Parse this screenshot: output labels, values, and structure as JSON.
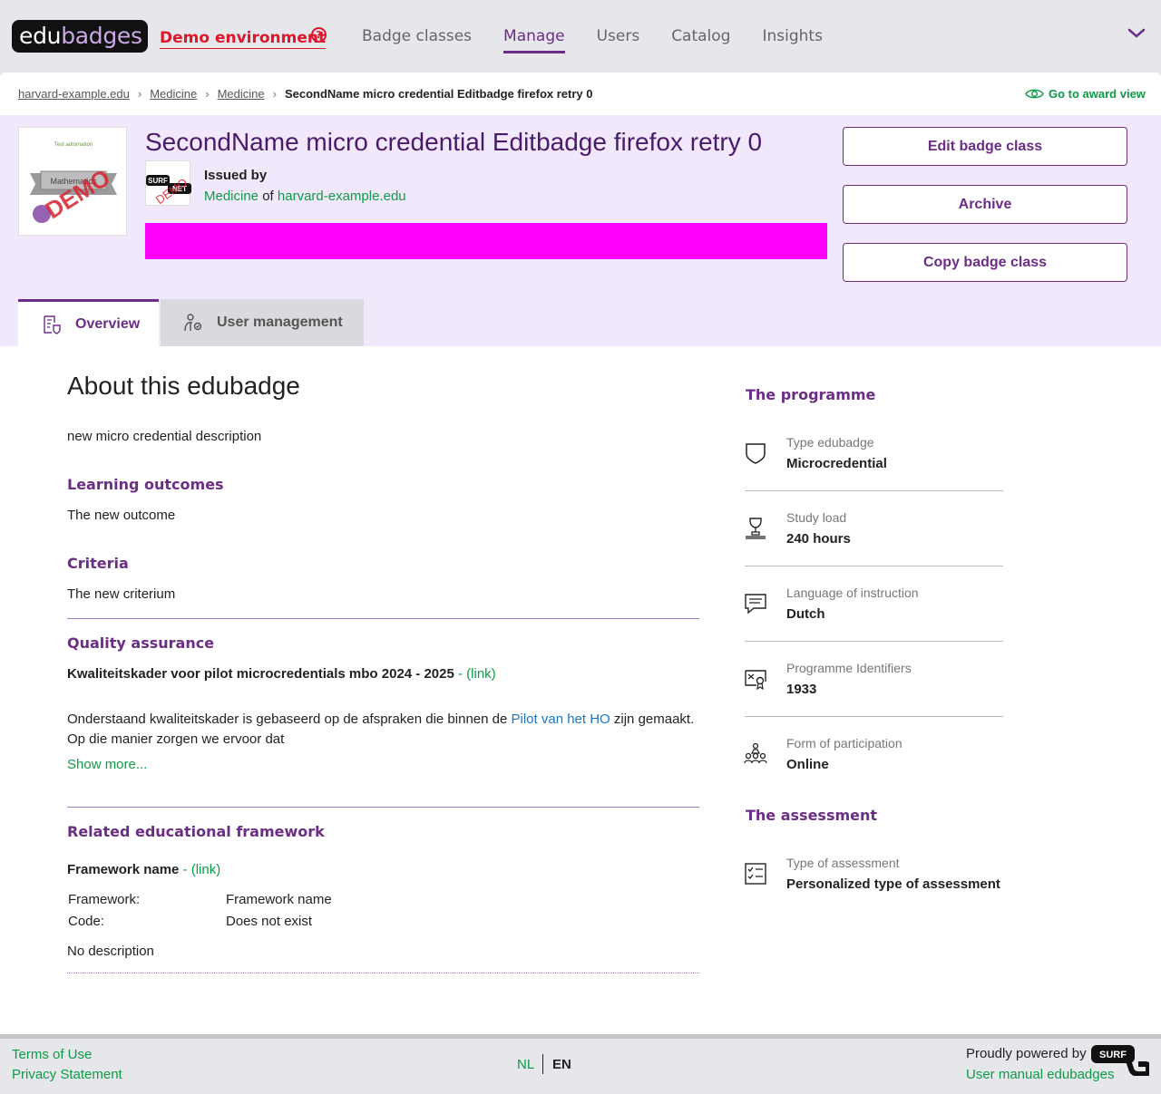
{
  "header": {
    "logo_part1": "edu",
    "logo_part2": "badges",
    "demo_label": "Demo environment",
    "nav": [
      "Badge classes",
      "Manage",
      "Users",
      "Catalog",
      "Insights"
    ],
    "active_nav": "Manage"
  },
  "breadcrumb": {
    "items": [
      "harvard-example.edu",
      "Medicine",
      "Medicine"
    ],
    "current": "SecondName micro credential Editbadge firefox retry 0",
    "award_view": "Go to award view"
  },
  "badge": {
    "title": "SecondName micro credential Editbadge firefox retry 0",
    "image_text_top": "Test automation",
    "image_text_banner": "Mathematics",
    "image_stamp": "DEMO",
    "issuer_logo_text": [
      "SURF",
      "NET"
    ],
    "issued_by_label": "Issued by",
    "issuer_faculty": "Medicine",
    "issuer_of": "of",
    "issuer_institution": "harvard-example.edu",
    "banner_color": "#ff00ff"
  },
  "actions": {
    "edit": "Edit badge class",
    "archive": "Archive",
    "copy": "Copy badge class"
  },
  "tabs": {
    "overview": "Overview",
    "user_management": "User management"
  },
  "about": {
    "heading": "About this edubadge",
    "description": "new micro credential description",
    "learning_outcomes_heading": "Learning outcomes",
    "learning_outcomes": "The new outcome",
    "criteria_heading": "Criteria",
    "criteria": "The new criterium",
    "qa_heading": "Quality assurance",
    "qa_title": "Kwaliteitskader voor pilot microcredentials mbo 2024 - 2025",
    "qa_link": "- (link)",
    "qa_text_before": "Onderstaand kwaliteitskader is gebaseerd op de afspraken die binnen de",
    "qa_text_link": "Pilot van het HO",
    "qa_text_after": "zijn gemaakt.",
    "qa_text_line2": "Op die manier zorgen we ervoor dat",
    "show_more": "Show more...",
    "framework_heading": "Related educational framework",
    "framework_title": "Framework name",
    "framework_link": "- (link)",
    "framework_label": "Framework:",
    "framework_value": "Framework name",
    "code_label": "Code:",
    "code_value": "Does not exist",
    "framework_description": "No description"
  },
  "programme": {
    "heading": "The programme",
    "items": [
      {
        "label": "Type edubadge",
        "value": "Microcredential",
        "icon": "shield-icon"
      },
      {
        "label": "Study load",
        "value": "240 hours",
        "icon": "trophy-icon"
      },
      {
        "label": "Language of instruction",
        "value": "Dutch",
        "icon": "chat-icon"
      },
      {
        "label": "Programme Identifiers",
        "value": "1933",
        "icon": "certificate-icon"
      },
      {
        "label": "Form of participation",
        "value": "Online",
        "icon": "group-icon"
      }
    ]
  },
  "assessment": {
    "heading": "The assessment",
    "label": "Type of assessment",
    "value": "Personalized type of assessment",
    "icon": "checklist-icon"
  },
  "footer": {
    "terms": "Terms of Use",
    "privacy": "Privacy Statement",
    "lang_nl": "NL",
    "lang_en": "EN",
    "powered_by": "Proudly powered by",
    "surf_logo_text": "SURF",
    "manual": "User manual edubadges"
  },
  "colors": {
    "brand_purple": "#6b2d86",
    "link_green": "#0f9a48",
    "demo_red": "#e0162b",
    "hero_bg": "#f1e9fb"
  }
}
